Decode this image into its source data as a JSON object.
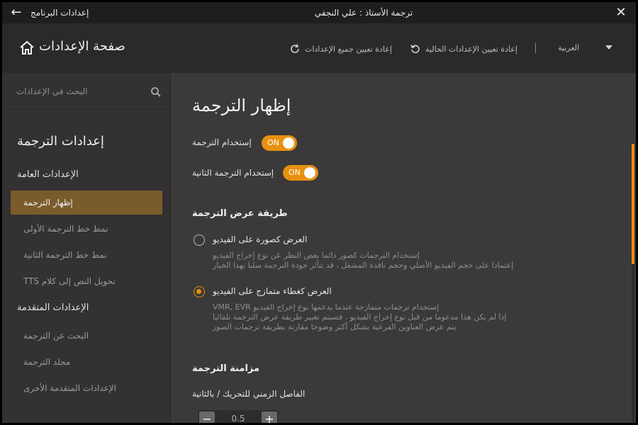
{
  "titlebar": {
    "title": "ترجمة الأستاذ : علي النجفي",
    "back_label": "إعدادات البرنامج"
  },
  "header": {
    "page_title": "صفحة الإعدادات",
    "reset_all": "إعادة تعيين جميع الإعدادات",
    "reset_current": "إعادة تعيين الإعدادات الحالية",
    "language": "العربية"
  },
  "sidebar": {
    "search_placeholder": "البحث في الإعدادات",
    "title": "إعدادات الترجمة",
    "general_group": "الإعدادات العامة",
    "advanced_group": "الإعدادات المتقدمة",
    "general_items": [
      {
        "label": "إظهار الترجمة"
      },
      {
        "label": "نمط خط الترجمة الأولى"
      },
      {
        "label": "نمط خط الترجمة الثانية"
      },
      {
        "label": "تحويل النص إلى كلام TTS"
      }
    ],
    "advanced_items": [
      {
        "label": "البحث عن الترجمة"
      },
      {
        "label": "مجلد الترجمة"
      },
      {
        "label": "الإعدادات المتقدمة الأخرى"
      }
    ]
  },
  "main": {
    "title": "إظهار الترجمة",
    "use_subtitle": {
      "label": "إستخدام الترجمة",
      "state": "ON"
    },
    "use_second_subtitle": {
      "label": "إستخدام الترجمة الثانية",
      "state": "ON"
    },
    "display_method": {
      "heading": "طريقة عرض الترجمة",
      "options": [
        {
          "title": "العرض كصورة على الفيديو",
          "desc1": "إستخدام الترجمات كصور دائما بغض النظر عن نوع إخراج الفيديو",
          "desc2": "إعتمادا على حجم الفيديو الأصلي وحجم نافذة المشغل ، قد تتأثر جودة الترجمة سلبا بهذا الخيار",
          "desc3": "",
          "selected": false
        },
        {
          "title": "العرض كغطاء متمازج على الفيديو",
          "desc1": "إستخدام ترجمات متمازجة عندما يدعمها نوع إخراج الفيديو VMR, EVR",
          "desc2": "إذا لم يكن هذا مدعوما من قبل نوع إخراج الفيديو ، فسيتم تغيير طريقة عرض الترجمة تلقائيا",
          "desc3": "يتم عرض العناوين الفرعية بشكل أكثر وضوحا مقارنة بطريقة ترجمات الصور",
          "selected": true
        }
      ]
    },
    "sync": {
      "heading": "مزامنة الترجمة",
      "interval_label": "الفاصل الزمني للتحريك / بالثانية",
      "value": "0.5"
    }
  },
  "colors": {
    "accent": "#e8900f",
    "active_item": "#7a5c2c"
  }
}
